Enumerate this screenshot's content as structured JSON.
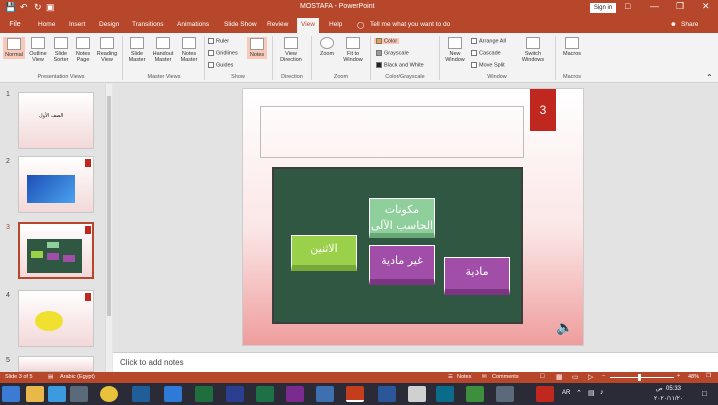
{
  "window": {
    "title": "MOSTAFA - PowerPoint",
    "sign_in": "Sign in",
    "share": "Share"
  },
  "tabs": [
    "File",
    "Home",
    "Insert",
    "Design",
    "Transitions",
    "Animations",
    "Slide Show",
    "Review",
    "View",
    "Help"
  ],
  "tell_me": "Tell me what you want to do",
  "ribbon": {
    "presentation_views": [
      "Normal",
      "Outline View",
      "Slide Sorter",
      "Notes Page",
      "Reading View"
    ],
    "master_views": [
      "Slide Master",
      "Handout Master",
      "Notes Master"
    ],
    "show_checks": [
      "Ruler",
      "Gridlines",
      "Guides"
    ],
    "notes": "Notes",
    "view_direction": "View Direction",
    "zoom": "Zoom",
    "fit_window": "Fit to Window",
    "color_items": [
      "Color",
      "Grayscale",
      "Black and White"
    ],
    "new_window": "New Window",
    "window_items": [
      "Arrange All",
      "Cascade",
      "Move Split"
    ],
    "switch_windows": "Switch Windows",
    "macros": "Macros",
    "groups": [
      "Presentation Views",
      "Master Views",
      "Show",
      "Direction",
      "Zoom",
      "Color/Grayscale",
      "Window",
      "Macros"
    ]
  },
  "slides": {
    "numbers": [
      "1",
      "2",
      "3",
      "4",
      "5"
    ],
    "thumb1_text": "الصف الأول"
  },
  "slide": {
    "badge": "3",
    "box_top": "مكونات الحاسب الآلى",
    "box_left": "الاثنين",
    "box_mid": "غير مادية",
    "box_right": "مادية"
  },
  "notes_placeholder": "Click to add notes",
  "status": {
    "slide": "Slide 3 of 5",
    "language": "Arabic (Egypt)",
    "notes": "Notes",
    "comments": "Comments",
    "zoom": "48%"
  },
  "clock": {
    "time": "05:33",
    "date": "٢٠٢٠/١١/٢٠",
    "ampm": "ص",
    "lang": "AR"
  },
  "colors": {
    "accent": "#b7472a",
    "board": "#2f5741",
    "badge": "#c0281f"
  }
}
